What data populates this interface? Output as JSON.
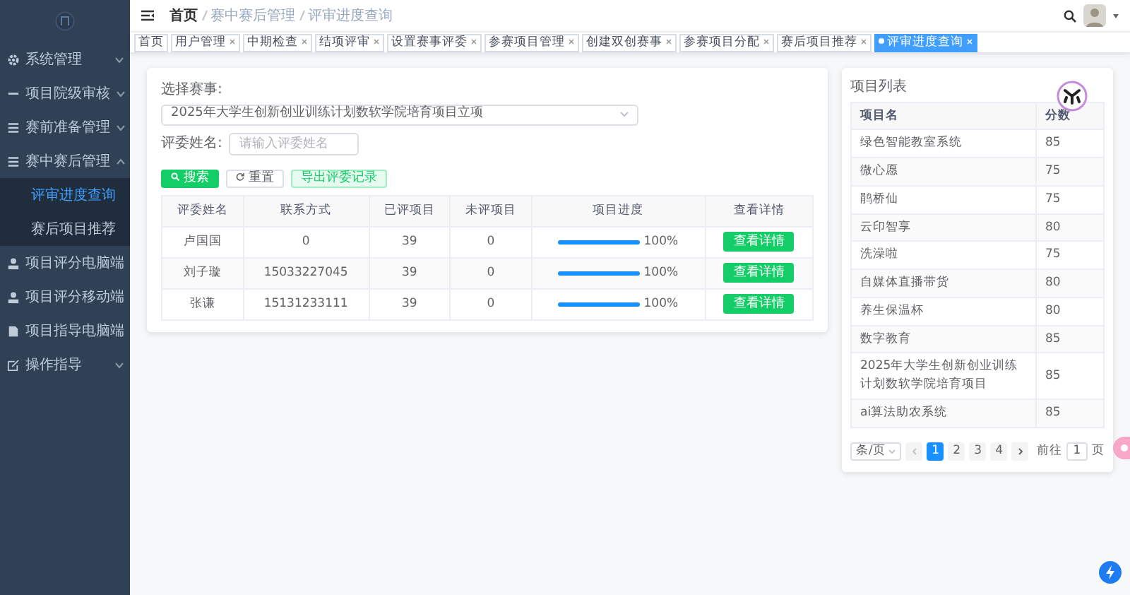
{
  "sidebar": {
    "items": [
      {
        "label": "系统管理",
        "expanded": false
      },
      {
        "label": "项目院级审核",
        "expanded": false
      },
      {
        "label": "赛前准备管理",
        "expanded": false
      },
      {
        "label": "赛中赛后管理",
        "expanded": true,
        "children": [
          {
            "label": "评审进度查询",
            "selected": true
          },
          {
            "label": "赛后项目推荐",
            "selected": false
          }
        ]
      },
      {
        "label": "项目评分电脑端"
      },
      {
        "label": "项目评分移动端"
      },
      {
        "label": "项目指导电脑端"
      },
      {
        "label": "操作指导",
        "expanded": false
      }
    ]
  },
  "breadcrumb": [
    "首页",
    "赛中赛后管理",
    "评审进度查询"
  ],
  "tabs": [
    {
      "label": "首页",
      "selected": false,
      "closable": false
    },
    {
      "label": "用户管理",
      "selected": false,
      "closable": true
    },
    {
      "label": "中期检查",
      "selected": false,
      "closable": true
    },
    {
      "label": "结项评审",
      "selected": false,
      "closable": true
    },
    {
      "label": "设置赛事评委",
      "selected": false,
      "closable": true
    },
    {
      "label": "参赛项目管理",
      "selected": false,
      "closable": true
    },
    {
      "label": "创建双创赛事",
      "selected": false,
      "closable": true
    },
    {
      "label": "参赛项目分配",
      "selected": false,
      "closable": true
    },
    {
      "label": "赛后项目推荐",
      "selected": false,
      "closable": true
    },
    {
      "label": "评审进度查询",
      "selected": true,
      "closable": true
    }
  ],
  "filters": {
    "event_label": "选择赛事:",
    "event_value": "2025年大学生创新创业训练计划数软学院培育项目立项",
    "judge_label": "评委姓名:",
    "judge_placeholder": "请输入评委姓名"
  },
  "buttons": [
    {
      "label": "搜索",
      "kind": "primary"
    },
    {
      "label": "重置",
      "kind": "reset"
    },
    {
      "label": "导出评委记录",
      "kind": "light"
    }
  ],
  "table": {
    "columns": [
      "评委姓名",
      "联系方式",
      "已评项目",
      "未评项目",
      "项目进度",
      "查看详情"
    ],
    "rows": [
      {
        "name": "卢国国",
        "phone": "0",
        "reviewed": "39",
        "pending": "0",
        "level": 1.0,
        "reading": "100%",
        "action": "查看详情"
      },
      {
        "name": "刘子璇",
        "phone": "15033227045",
        "reviewed": "39",
        "pending": "0",
        "level": 1.0,
        "reading": "100%",
        "action": "查看详情"
      },
      {
        "name": "张谦",
        "phone": "15131233111",
        "reviewed": "39",
        "pending": "0",
        "level": 1.0,
        "reading": "100%",
        "action": "查看详情"
      }
    ]
  },
  "project_panel": {
    "title": "项目列表",
    "columns": [
      "项目名",
      "分数"
    ],
    "rows": [
      {
        "name": "绿色智能教室系统",
        "score": "85"
      },
      {
        "name": "微心愿",
        "score": "75"
      },
      {
        "name": "鹃桥仙",
        "score": "75"
      },
      {
        "name": "云印智享",
        "score": "80"
      },
      {
        "name": "洗澡啦",
        "score": "75"
      },
      {
        "name": "自媒体直播带货",
        "score": "80"
      },
      {
        "name": "养生保温杯",
        "score": "80"
      },
      {
        "name": "数字教育",
        "score": "85"
      },
      {
        "name": "2025年大学生创新创业训练计划数软学院培育项目",
        "score": "85"
      },
      {
        "name": "ai算法助农系统",
        "score": "85"
      }
    ],
    "pagination": {
      "page_size": "条/页",
      "pages": [
        {
          "label": "1",
          "selected": true
        },
        {
          "label": "2",
          "selected": false
        },
        {
          "label": "3",
          "selected": false
        },
        {
          "label": "4",
          "selected": false
        }
      ],
      "goto_label": "前往",
      "goto_value": "1",
      "goto_suffix": "页"
    }
  }
}
